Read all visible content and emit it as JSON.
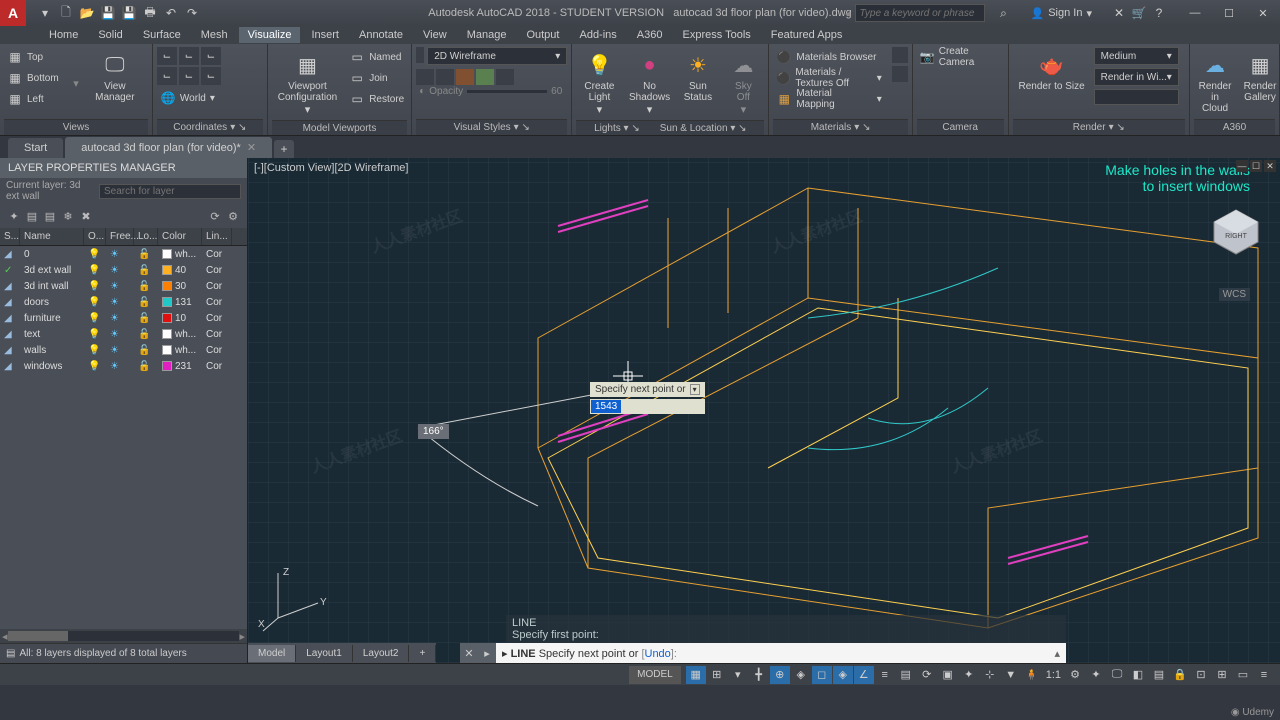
{
  "title": {
    "app": "Autodesk AutoCAD 2018 - STUDENT VERSION",
    "file": "autocad 3d floor plan (for video).dwg",
    "search_placeholder": "Type a keyword or phrase",
    "sign_in": "Sign In"
  },
  "menu": {
    "tabs": [
      "Home",
      "Solid",
      "Surface",
      "Mesh",
      "Visualize",
      "Insert",
      "Annotate",
      "View",
      "Manage",
      "Output",
      "Add-ins",
      "A360",
      "Express Tools",
      "Featured Apps"
    ],
    "active": "Visualize"
  },
  "ribbon": {
    "views": {
      "title": "Views",
      "top": "Top",
      "bottom": "Bottom",
      "left": "Left",
      "view_manager": "View\nManager"
    },
    "coords": {
      "title": "Coordinates",
      "world": "World"
    },
    "modelvp": {
      "title": "Model Viewports",
      "vpconfig": "Viewport\nConfiguration",
      "named": "Named",
      "join": "Join",
      "restore": "Restore"
    },
    "vstyles": {
      "title": "Visual Styles",
      "style": "2D Wireframe",
      "opacity": "Opacity",
      "opacity_val": "60"
    },
    "lights": {
      "title": "Lights",
      "create": "Create\nLight",
      "noshadow": "No\nShadows",
      "sun": "Sun\nStatus",
      "sky": "Sky Off"
    },
    "sunloc": {
      "title": "Sun & Location"
    },
    "materials": {
      "title": "Materials",
      "browser": "Materials Browser",
      "textures": "Materials / Textures Off",
      "mapping": "Material Mapping"
    },
    "camera": {
      "title": "Camera",
      "create": "Create Camera"
    },
    "render": {
      "title": "Render",
      "tosize": "Render to Size",
      "quality": "Medium",
      "window": "Render in Wi...",
      "cloud": "Render in\nCloud",
      "gallery": "Render\nGallery"
    },
    "a360": {
      "title": "A360"
    }
  },
  "file_tabs": {
    "start": "Start",
    "current": "autocad 3d floor plan (for video)*"
  },
  "layer_panel": {
    "title": "LAYER PROPERTIES MANAGER",
    "current": "Current layer: 3d ext wall",
    "search_placeholder": "Search for layer",
    "columns": {
      "s": "S...",
      "name": "Name",
      "on": "O...",
      "freeze": "Free...",
      "lock": "Lo...",
      "color": "Color",
      "line": "Lin..."
    },
    "layers": [
      {
        "name": "0",
        "color": "#ffffff",
        "color_label": "wh...",
        "line": "Cor"
      },
      {
        "name": "3d ext wall",
        "color": "#ffb020",
        "color_label": "40",
        "line": "Cor",
        "current": true
      },
      {
        "name": "3d int wall",
        "color": "#ff8000",
        "color_label": "30",
        "line": "Cor"
      },
      {
        "name": "doors",
        "color": "#20c8c8",
        "color_label": "131",
        "line": "Cor"
      },
      {
        "name": "furniture",
        "color": "#e01010",
        "color_label": "10",
        "line": "Cor"
      },
      {
        "name": "text",
        "color": "#ffffff",
        "color_label": "wh...",
        "line": "Cor"
      },
      {
        "name": "walls",
        "color": "#ffffff",
        "color_label": "wh...",
        "line": "Cor"
      },
      {
        "name": "windows",
        "color": "#e020c0",
        "color_label": "231",
        "line": "Cor"
      }
    ],
    "status": "All: 8 layers displayed of 8 total layers"
  },
  "viewport": {
    "label": "[-][Custom View][2D Wireframe]",
    "annotation_l1": "Make holes in the walls",
    "annotation_l2": "to insert windows",
    "wcs": "WCS",
    "cube_face": "RIGHT",
    "angle": "166°",
    "dyn_prompt": "Specify next point or",
    "dyn_value": "1543",
    "axes": {
      "x": "X",
      "y": "Y",
      "z": "Z"
    }
  },
  "command": {
    "history_l1": "LINE",
    "history_l2": "Specify first point:",
    "prompt_cmd": "LINE",
    "prompt_text": "Specify next point or",
    "prompt_option": "Undo"
  },
  "bottom_tabs": [
    "Model",
    "Layout1",
    "Layout2"
  ],
  "statusbar": {
    "model": "MODEL",
    "scale": "1:1"
  }
}
